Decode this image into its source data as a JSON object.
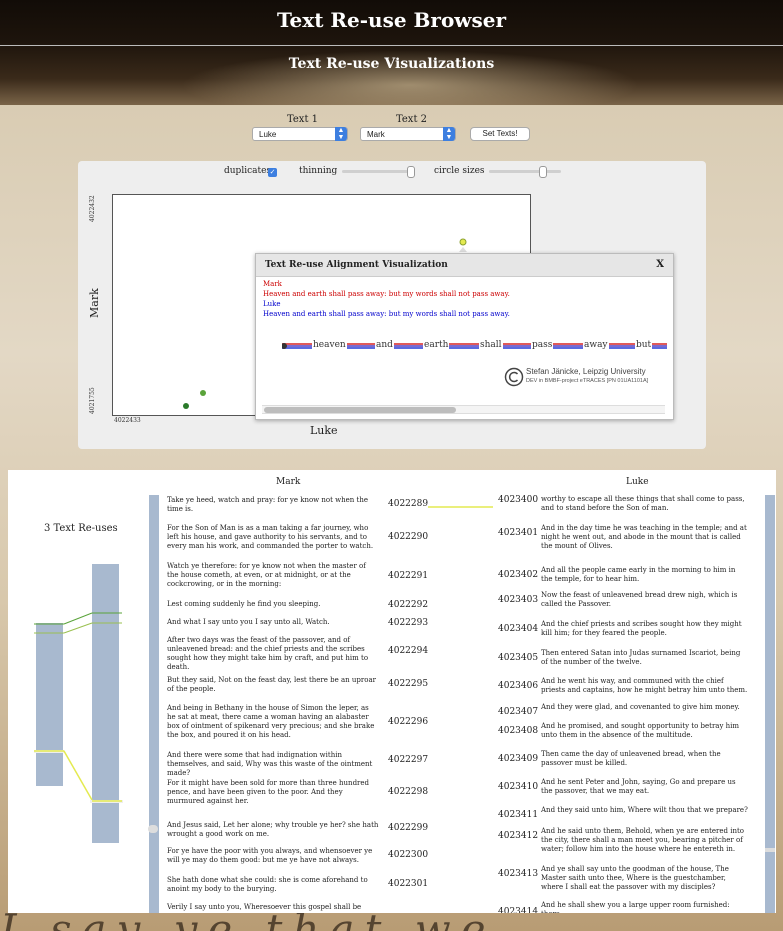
{
  "app": {
    "title": "Text Re-use Browser",
    "subtitle": "Text Re-use Visualizations"
  },
  "selectors": {
    "text1_label": "Text 1",
    "text1_value": "Luke",
    "text2_label": "Text 2",
    "text2_value": "Mark",
    "set_button": "Set Texts!"
  },
  "controls": {
    "duplicates_label": "duplicates",
    "duplicates_checked": true,
    "thinning_label": "thinning",
    "thinning_level": 0.98,
    "circle_label": "circle sizes",
    "circle_level": 0.75
  },
  "plot": {
    "y_label": "Mark",
    "x_label": "Luke",
    "y_top_tick": "4022432",
    "y_bottom_tick": "4021755",
    "x_left_tick": "4022433"
  },
  "popup": {
    "title": "Text Re-use Alignment Visualization",
    "close": "X",
    "source1_name": "Mark",
    "source1_text": "Heaven and earth shall pass away: but my words shall not pass away.",
    "source2_name": "Luke",
    "source2_text": "Heaven and earth shall pass away: but my words shall not pass away.",
    "words": [
      "heaven",
      "and",
      "earth",
      "shall",
      "pass",
      "away",
      "but"
    ],
    "logo_line1": "Stefan Jänicke, Leipzig University",
    "logo_line2": "DEV in BMBF-project eTRACES [PN 01UA1101A]"
  },
  "browser": {
    "mark_header": "Mark",
    "luke_header": "Luke",
    "reuse_count": "3 Text Re-uses",
    "mark_rows": [
      {
        "text": "Take ye heed, watch and pray: for ye know not when the time is.",
        "id": "4022289"
      },
      {
        "text": "For the Son of Man is as a man taking a far journey, who left his house, and gave authority to his servants, and to every man his work, and commanded the porter to watch.",
        "id": "4022290"
      },
      {
        "text": "Watch ye therefore: for ye know not when the master of the house cometh, at even, or at midnight, or at the cockcrowing, or in the morning:",
        "id": "4022291"
      },
      {
        "text": "Lest coming suddenly he find you sleeping.",
        "id": "4022292"
      },
      {
        "text": "And what I say unto you I say unto all, Watch.",
        "id": "4022293"
      },
      {
        "text": "After two days was the feast of the passover, and of unleavened bread: and the chief priests and the scribes sought how they might take him by craft, and put him to death.",
        "id": "4022294"
      },
      {
        "text": "But they said, Not on the feast day, lest there be an uproar of the people.",
        "id": "4022295"
      },
      {
        "text": "And being in Bethany in the house of Simon the leper, as he sat at meat, there came a woman having an alabaster box of ointment of spikenard very precious; and she brake the box, and poured it on his head.",
        "id": "4022296"
      },
      {
        "text": "And there were some that had indignation within themselves, and said, Why was this waste of the ointment made?",
        "id": "4022297"
      },
      {
        "text": "For it might have been sold for more than three hundred pence, and have been given to the poor. And they murmured against her.",
        "id": "4022298"
      },
      {
        "text": "And Jesus said, Let her alone; why trouble ye her? she hath wrought a good work on me.",
        "id": "4022299"
      },
      {
        "text": "For ye have the poor with you always, and whensoever ye will ye may do them good: but me ye have not always.",
        "id": "4022300"
      },
      {
        "text": "She hath done what she could: she is come aforehand to anoint my body to the burying.",
        "id": "4022301"
      },
      {
        "text": "Verily I say unto you, Wheresoever this gospel shall be",
        "id": ""
      }
    ],
    "luke_rows": [
      {
        "id": "4023400",
        "text": "worthy to escape all these things that shall come to pass, and to stand before the Son of man."
      },
      {
        "id": "4023401",
        "text": "And in the day time he was teaching in the temple; and at night he went out, and abode in the mount that is called the mount of Olives."
      },
      {
        "id": "4023402",
        "text": "And all the people came early in the morning to him in the temple, for to hear him."
      },
      {
        "id": "4023403",
        "text": "Now the feast of unleavened bread drew nigh, which is called the Passover."
      },
      {
        "id": "4023404",
        "text": "And the chief priests and scribes sought how they might kill him; for they feared the people."
      },
      {
        "id": "4023405",
        "text": "Then entered Satan into Judas surnamed Iscariot, being of the number of the twelve."
      },
      {
        "id": "4023406",
        "text": "And he went his way, and communed with the chief priests and captains, how he might betray him unto them."
      },
      {
        "id": "4023407",
        "text": "And they were glad, and covenanted to give him money."
      },
      {
        "id": "4023408",
        "text": "And he promised, and sought opportunity to betray him unto them in the absence of the multitude."
      },
      {
        "id": "4023409",
        "text": "Then came the day of unleavened bread, when the passover must be killed."
      },
      {
        "id": "4023410",
        "text": "And he sent Peter and John, saying, Go and prepare us the passover, that we may eat."
      },
      {
        "id": "4023411",
        "text": "And they said unto him, Where wilt thou that we prepare?"
      },
      {
        "id": "4023412",
        "text": "And he said unto them, Behold, when ye are entered into the city, there shall a man meet you, bearing a pitcher of water; follow him into the house where he entereth in."
      },
      {
        "id": "4023413",
        "text": "And ye shall say unto the goodman of the house, The Master saith unto thee, Where is the guestchamber, where I shall eat the passover with my disciples?"
      },
      {
        "id": "4023414",
        "text": "And he shall shew you a large upper room furnished: there"
      }
    ]
  },
  "colors": {
    "mark": "#cc0000",
    "luke": "#0000cc",
    "accent": "#3d7fe0",
    "bar": "#a8b9cf"
  }
}
